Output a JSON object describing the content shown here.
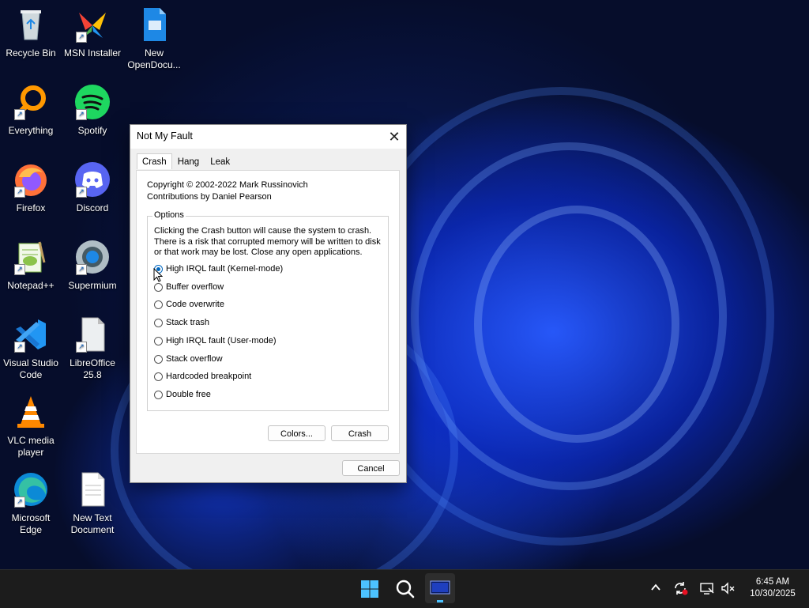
{
  "desktop": {
    "icons": [
      {
        "label": "Recycle Bin"
      },
      {
        "label": "MSN Installer"
      },
      {
        "label": "New OpenDocu..."
      },
      {
        "label": "Everything"
      },
      {
        "label": "Spotify"
      },
      {
        "label": "Firefox"
      },
      {
        "label": "Discord"
      },
      {
        "label": "Notepad++"
      },
      {
        "label": "Supermium"
      },
      {
        "label": "Visual Studio Code"
      },
      {
        "label": "LibreOffice 25.8"
      },
      {
        "label": "VLC media player"
      },
      {
        "label": "Microsoft Edge"
      },
      {
        "label": "New Text Document"
      }
    ]
  },
  "dialog": {
    "title": "Not My Fault",
    "close_glyph": "✕",
    "tabs": [
      {
        "label": "Crash",
        "active": true
      },
      {
        "label": "Hang",
        "active": false
      },
      {
        "label": "Leak",
        "active": false
      }
    ],
    "copyright_line1": "Copyright © 2002-2022 Mark Russinovich",
    "copyright_line2": "Contributions by Daniel Pearson",
    "options_legend": "Options",
    "description_line1": "Clicking the Crash button will cause the system to crash.",
    "description_line2": "There is a risk that corrupted memory will be written to disk",
    "description_line3": "or that work may be lost. Close any open applications.",
    "options": [
      {
        "label": "High IRQL fault (Kernel-mode)",
        "checked": true
      },
      {
        "label": "Buffer overflow",
        "checked": false
      },
      {
        "label": "Code overwrite",
        "checked": false
      },
      {
        "label": "Stack trash",
        "checked": false
      },
      {
        "label": "High IRQL fault (User-mode)",
        "checked": false
      },
      {
        "label": "Stack overflow",
        "checked": false
      },
      {
        "label": "Hardcoded breakpoint",
        "checked": false
      },
      {
        "label": "Double free",
        "checked": false
      }
    ],
    "colors_button": "Colors...",
    "crash_button": "Crash",
    "cancel_button": "Cancel"
  },
  "taskbar": {
    "time": "6:45 AM",
    "date": "10/30/2025",
    "accent": "#0078d4"
  }
}
